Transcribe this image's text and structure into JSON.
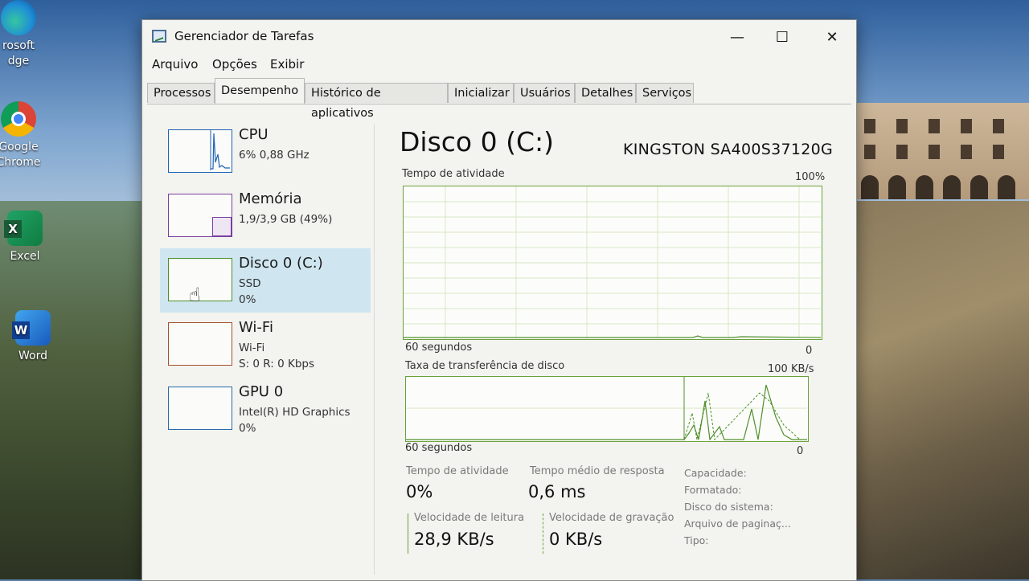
{
  "desktop": {
    "icons": [
      {
        "label_1": "rosoft",
        "label_2": "dge",
        "icon": "edge-icon"
      },
      {
        "label_1": "Google",
        "label_2": "Chrome",
        "icon": "chrome-icon"
      },
      {
        "label_1": "Excel",
        "icon": "excel-icon"
      },
      {
        "label_1": "Word",
        "icon": "word-icon"
      }
    ]
  },
  "window": {
    "title": "Gerenciador de Tarefas",
    "controls": {
      "minimize": "—",
      "maximize": "☐",
      "close": "✕"
    }
  },
  "menu": [
    "Arquivo",
    "Opções",
    "Exibir"
  ],
  "tabs": [
    {
      "label": "Processos"
    },
    {
      "label": "Desempenho",
      "active": true
    },
    {
      "label": "Histórico de aplicativos"
    },
    {
      "label": "Inicializar"
    },
    {
      "label": "Usuários"
    },
    {
      "label": "Detalhes"
    },
    {
      "label": "Serviços"
    }
  ],
  "side_items": [
    {
      "title": "CPU",
      "line1": "6% 0,88 GHz",
      "line2": "",
      "color": "#1e62b4"
    },
    {
      "title": "Memória",
      "line1": "1,9/3,9 GB (49%)",
      "line2": "",
      "color": "#7a3fa0"
    },
    {
      "title": "Disco 0 (C:)",
      "line1": "SSD",
      "line2": "0%",
      "color": "#4f8f2a",
      "selected": true
    },
    {
      "title": "Wi-Fi",
      "line1": "Wi-Fi",
      "line2": "S: 0 R: 0 Kbps",
      "color": "#a0522d"
    },
    {
      "title": "GPU 0",
      "line1": "Intel(R) HD Graphics",
      "line2": "0%",
      "color": "#2a6aa8"
    }
  ],
  "detail": {
    "title": "Disco 0 (C:)",
    "model": "KINGSTON SA400S37120G",
    "graph1": {
      "label": "Tempo de atividade",
      "max": "100%",
      "time": "60 segundos",
      "min": "0"
    },
    "graph2": {
      "label": "Taxa de transferência de disco",
      "max": "100 KB/s",
      "time": "60 segundos",
      "min": "0"
    },
    "stats": {
      "active_time_label": "Tempo de atividade",
      "active_time_value": "0%",
      "response_label": "Tempo médio de resposta",
      "response_value": "0,6 ms",
      "read_label": "Velocidade de leitura",
      "read_value": "28,9 KB/s",
      "write_label": "Velocidade de gravação",
      "write_value": "0 KB/s"
    },
    "info_labels": [
      "Capacidade:",
      "Formatado:",
      "Disco do sistema:",
      "Arquivo de paginaç...",
      "Tipo:"
    ]
  }
}
